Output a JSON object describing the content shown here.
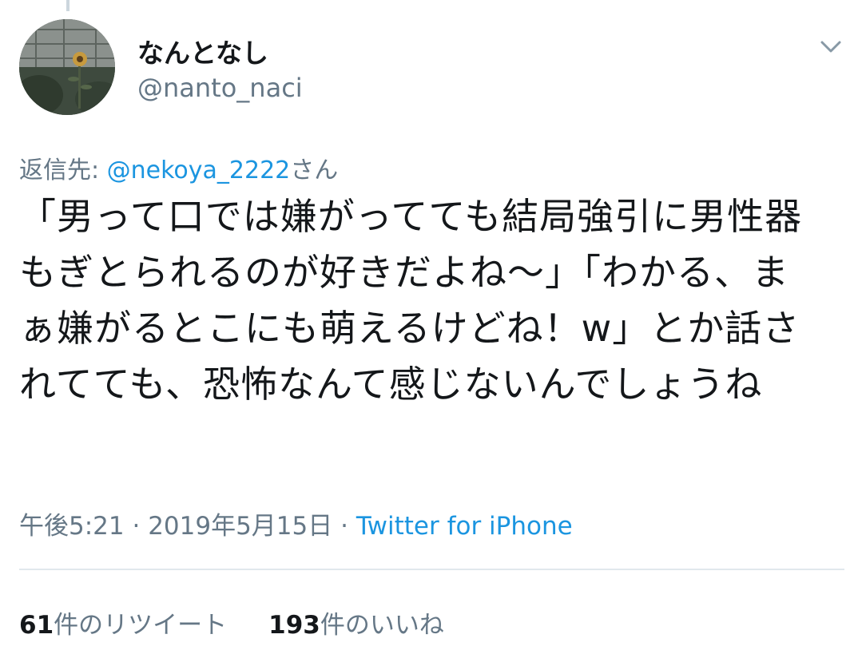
{
  "user": {
    "display_name": "なんとなし",
    "handle": "@nanto_naci"
  },
  "reply": {
    "prefix": "返信先: ",
    "mention": "@nekoya_2222",
    "suffix": "さん"
  },
  "tweet": {
    "text": "「男って口では嫌がってても結局強引に男性器もぎとられるのが好きだよね〜」「わかる、まぁ嫌がるとこにも萌えるけどね！w」とか話されてても、恐怖なんて感じないんでしょうね"
  },
  "meta": {
    "time": "午後5:21",
    "separator1": " · ",
    "date": "2019年5月15日",
    "separator2": " · ",
    "source": "Twitter for iPhone"
  },
  "stats": {
    "retweets_count": "61",
    "retweets_label": "件のリツイート",
    "likes_count": "193",
    "likes_label": "件のいいね"
  },
  "icons": {
    "avatar": "avatar-photo-sunflower",
    "menu": "chevron-down-icon"
  },
  "colors": {
    "link": "#1b95e0",
    "secondary_text": "#657786",
    "primary_text": "#14171a",
    "divider": "#e1e8ed"
  }
}
